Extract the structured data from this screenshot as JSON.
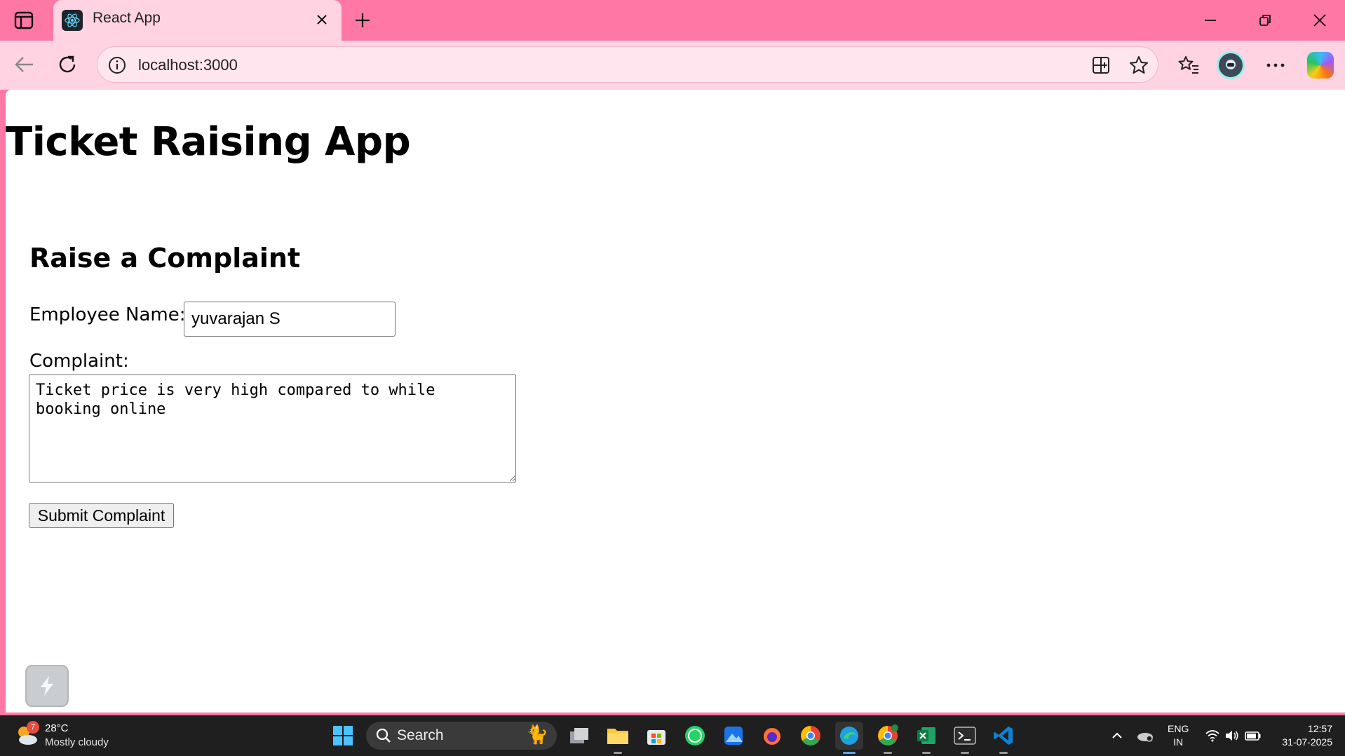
{
  "browser": {
    "tab_title": "React App",
    "url": "localhost:3000"
  },
  "page": {
    "title": "Ticket Raising App",
    "section_title": "Raise a Complaint",
    "employee_label": "Employee Name:",
    "employee_value": "yuvarajan S",
    "complaint_label": "Complaint:",
    "complaint_value": "Ticket price is very high compared to while booking online",
    "submit_label": "Submit Complaint"
  },
  "taskbar": {
    "weather_temp": "28°C",
    "weather_desc": "Mostly cloudy",
    "weather_badge": "7",
    "search_label": "Search",
    "lang_line1": "ENG",
    "lang_line2": "IN",
    "time": "12:57",
    "date": "31-07-2025",
    "apps": [
      "task-view",
      "file-explorer",
      "microsoft-store",
      "whatsapp",
      "photos",
      "firefox",
      "chrome",
      "edge",
      "chrome-profile",
      "excel",
      "terminal",
      "vscode"
    ]
  },
  "colors": {
    "browser_frame": "#ff77a5",
    "browser_toolbar": "#ffd3e1",
    "taskbar": "#1f1f1f"
  }
}
